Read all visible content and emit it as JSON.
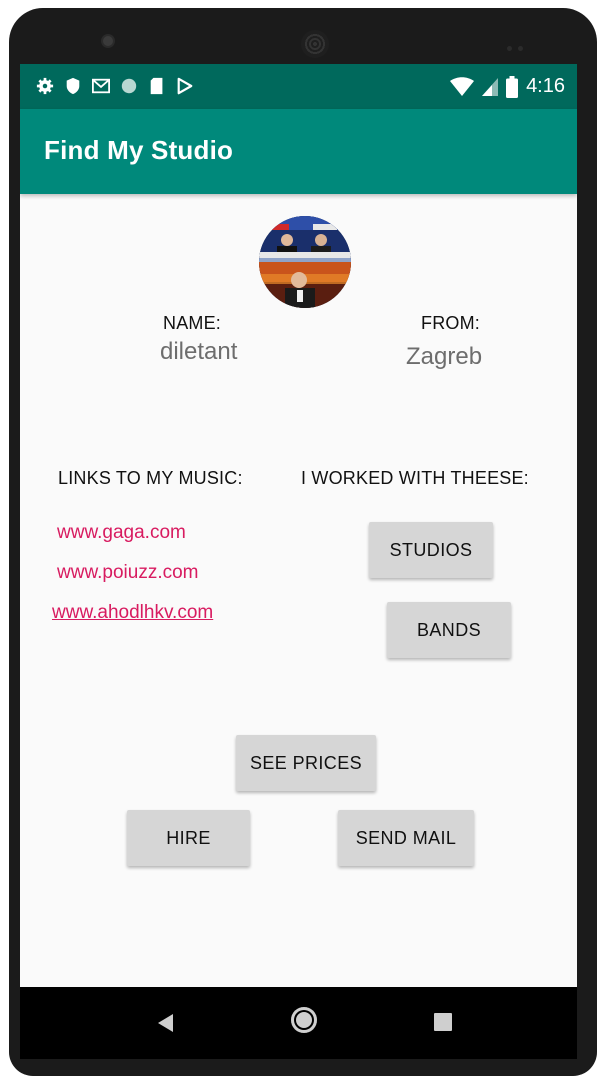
{
  "status": {
    "time": "4:16",
    "left_icons": [
      "gear-icon",
      "shield-icon",
      "gmail-icon",
      "circle-icon",
      "sd-card-icon",
      "play-store-icon"
    ],
    "right_icons": [
      "wifi-icon",
      "signal-icon",
      "battery-icon"
    ]
  },
  "appbar": {
    "title": "Find My Studio"
  },
  "profile": {
    "name_label": "NAME:",
    "name_value": "diletant",
    "from_label": "FROM:",
    "from_value": "Zagreb"
  },
  "links": {
    "heading": "LINKS TO MY MUSIC:",
    "items": [
      "www.gaga.com",
      "www.poiuzz.com",
      "www.ahodlhkv.com"
    ]
  },
  "worked": {
    "heading": "I WORKED WITH THEESE:",
    "studios_button": "STUDIOS",
    "bands_button": "BANDS"
  },
  "actions": {
    "see_prices": "SEE PRICES",
    "hire": "HIRE",
    "send_mail": "SEND MAIL"
  },
  "colors": {
    "status_bar": "#00695c",
    "app_bar": "#00897b",
    "link": "#d81b60",
    "button": "#d6d6d6"
  }
}
